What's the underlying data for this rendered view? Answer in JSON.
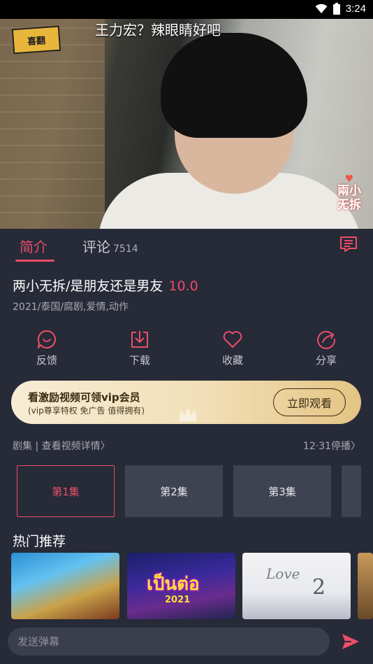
{
  "status_bar": {
    "time": "3:24"
  },
  "video": {
    "subtitle": "王力宏？辣眼睛好吧",
    "logo_text": "喜翻",
    "watermark_line1": "兩小",
    "watermark_line2": "无拆"
  },
  "tabs": {
    "intro_label": "简介",
    "comments_label": "评论",
    "comments_count": "7514"
  },
  "show": {
    "title": "两小无拆/是朋友还是男友",
    "score": "10.0",
    "meta": "2021/泰国/腐剧,爱情,动作"
  },
  "actions": [
    {
      "label": "反馈",
      "icon": "feedback-icon"
    },
    {
      "label": "下载",
      "icon": "download-icon"
    },
    {
      "label": "收藏",
      "icon": "heart-icon"
    },
    {
      "label": "分享",
      "icon": "share-icon"
    }
  ],
  "vip": {
    "title": "看激励视频可领vip会员",
    "subtitle": "(vip尊享特权 免广告 值得拥有)",
    "button": "立即观看"
  },
  "episodes": {
    "header": "剧集 | 查看视频详情〉",
    "update": "12·31停播〉",
    "items": [
      "第1集",
      "第2集",
      "第3集"
    ]
  },
  "recommendations": {
    "title": "热门推荐",
    "items": [
      {
        "text": ""
      },
      {
        "text": "เป็นต่อ",
        "year": "2021"
      },
      {
        "text": "Love",
        "num": "2"
      },
      {
        "text": ""
      }
    ]
  },
  "bottom": {
    "placeholder": "发送弹幕"
  },
  "colors": {
    "accent": "#ec4d6a",
    "background": "#272a37",
    "episode_bg": "#3f4250"
  }
}
